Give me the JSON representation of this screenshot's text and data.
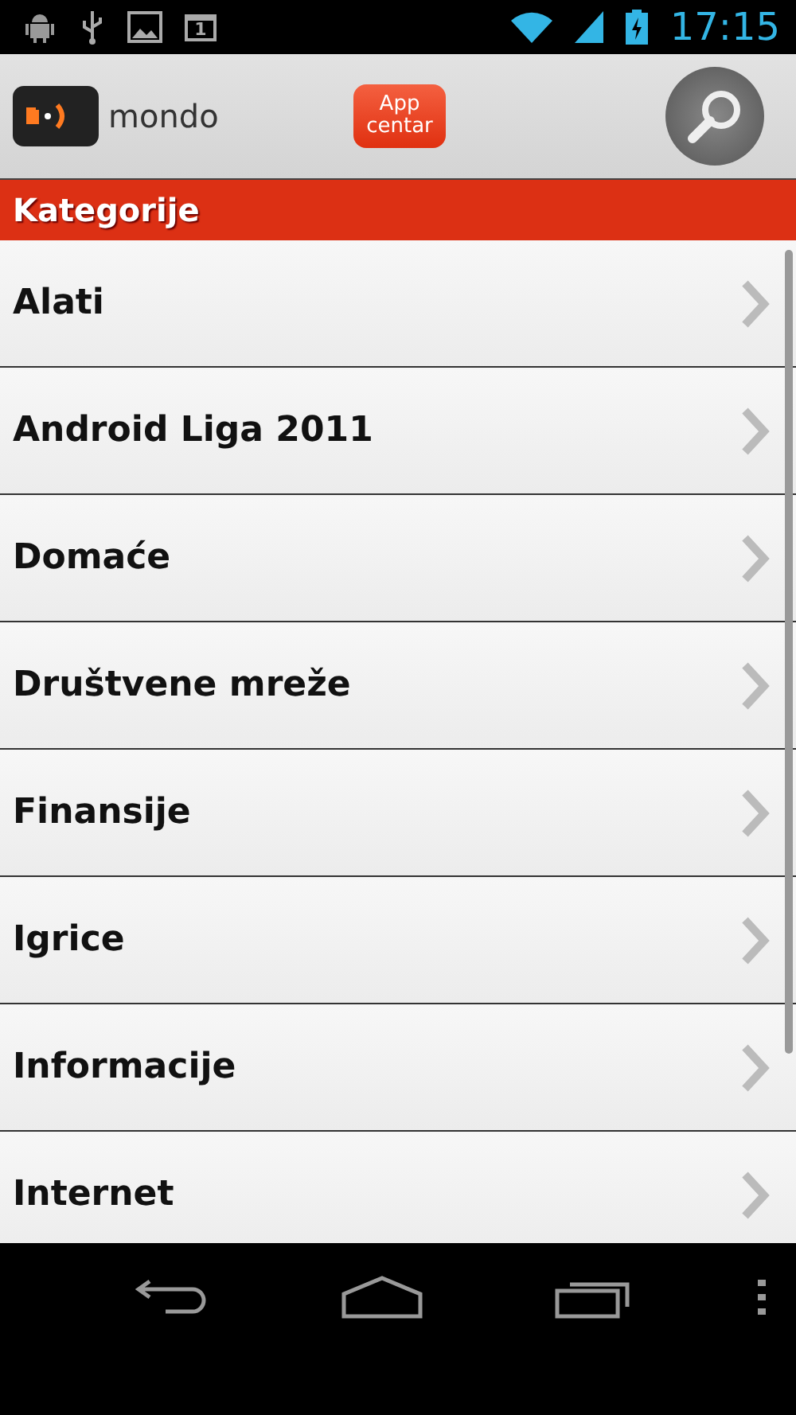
{
  "status_bar": {
    "notification_count": "1",
    "time": "17:15"
  },
  "header": {
    "logo_text": "mondo",
    "app_center": [
      "App",
      "centar"
    ]
  },
  "section_title": "Kategorije",
  "categories": [
    {
      "label": "Alati"
    },
    {
      "label": "Android Liga 2011"
    },
    {
      "label": "Domaće"
    },
    {
      "label": "Društvene mreže"
    },
    {
      "label": "Finansije"
    },
    {
      "label": "Igrice"
    },
    {
      "label": "Informacije"
    },
    {
      "label": "Internet"
    }
  ]
}
